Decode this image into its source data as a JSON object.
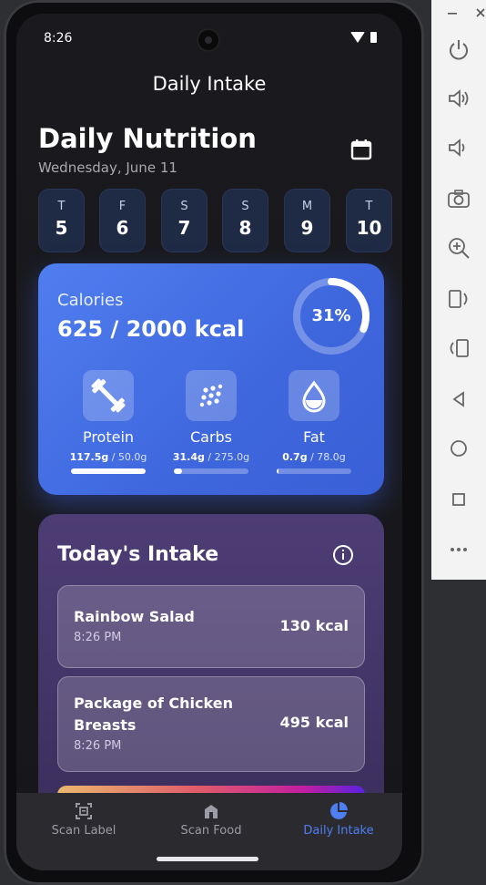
{
  "status_bar": {
    "time": "8:26"
  },
  "app_bar": {
    "title": "Daily Intake"
  },
  "header": {
    "title": "Daily Nutrition",
    "date": "Wednesday, June 11"
  },
  "days": [
    {
      "letter": "T",
      "number": "5"
    },
    {
      "letter": "F",
      "number": "6"
    },
    {
      "letter": "S",
      "number": "7"
    },
    {
      "letter": "S",
      "number": "8"
    },
    {
      "letter": "M",
      "number": "9"
    },
    {
      "letter": "T",
      "number": "10"
    }
  ],
  "calories": {
    "label": "Calories",
    "value": "625 / 2000 kcal",
    "percent_text": "31%",
    "percent": 0.31
  },
  "macros": [
    {
      "name": "Protein",
      "amount": "117.5g",
      "target": " / 50.0g",
      "progress": 1.0,
      "icon": "dumbbell-icon"
    },
    {
      "name": "Carbs",
      "amount": "31.4g",
      "target": " / 275.0g",
      "progress": 0.114,
      "icon": "grain-dots-icon"
    },
    {
      "name": "Fat",
      "amount": "0.7g",
      "target": " / 78.0g",
      "progress": 0.009,
      "icon": "drop-icon"
    }
  ],
  "intake": {
    "title": "Today's Intake",
    "meals": [
      {
        "name": "Rainbow Salad",
        "time": "8:26 PM",
        "kcal": "130 kcal"
      },
      {
        "name": "Package of Chicken Breasts",
        "time": "8:26 PM",
        "kcal": "495 kcal"
      }
    ]
  },
  "nav": [
    {
      "label": "Scan Label",
      "icon": "scan-label-icon",
      "active": false
    },
    {
      "label": "Scan Food",
      "icon": "scan-food-icon",
      "active": false
    },
    {
      "label": "Daily Intake",
      "icon": "pie-chart-icon",
      "active": true
    }
  ],
  "colors": {
    "accent": "#4f7ef0",
    "card_blue": "#4a75e8",
    "card_purple": "#45376a",
    "background": "#17171b"
  },
  "emulator_toolbar": [
    "power-icon",
    "volume-up-icon",
    "volume-down-icon",
    "camera-icon",
    "zoom-in-icon",
    "rotate-left-icon",
    "rotate-right-icon",
    "back-icon",
    "home-icon",
    "overview-icon",
    "more-icon"
  ]
}
